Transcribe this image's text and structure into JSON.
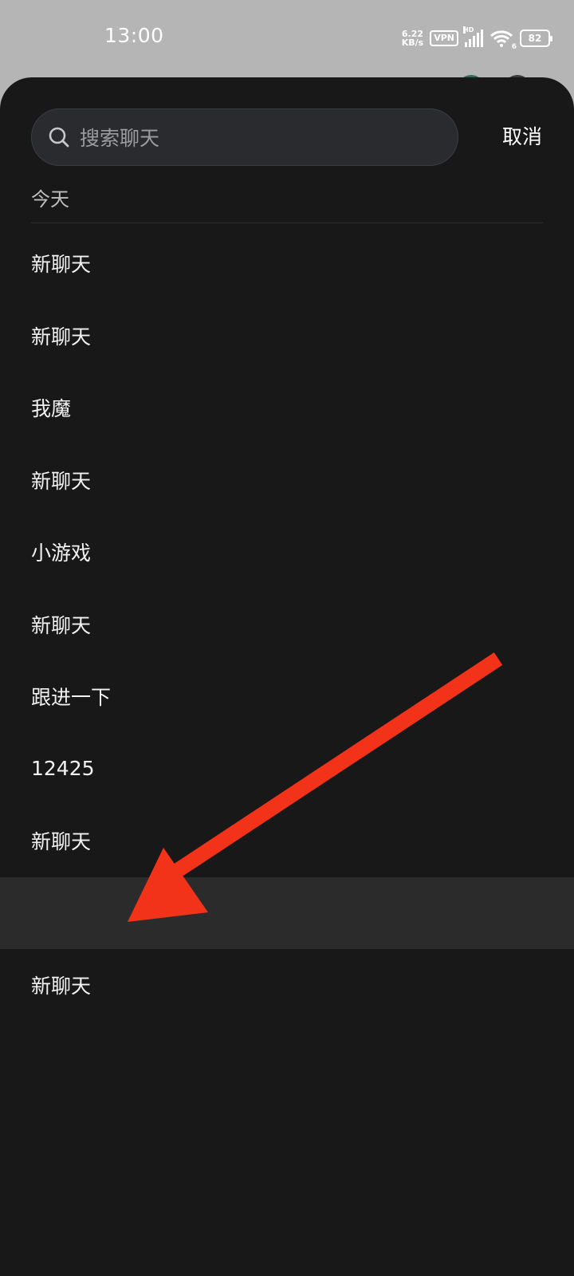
{
  "status_bar": {
    "time": "13:00",
    "speed_value": "6.22",
    "speed_unit": "KB/s",
    "vpn": "VPN",
    "hd": "HD",
    "wifi_badge": "6",
    "battery": "82"
  },
  "search": {
    "placeholder": "搜索聊天",
    "cancel_label": "取消"
  },
  "history": {
    "section_title": "今天",
    "items": [
      {
        "label": "新聊天"
      },
      {
        "label": "新聊天"
      },
      {
        "label": "我魔"
      },
      {
        "label": "新聊天"
      },
      {
        "label": "小游戏"
      },
      {
        "label": "新聊天"
      },
      {
        "label": "跟进一下"
      },
      {
        "label": "12425"
      },
      {
        "label": "新聊天"
      },
      {
        "label": ""
      },
      {
        "label": "新聊天"
      }
    ]
  },
  "colors": {
    "sheet_background": "#181819",
    "highlight_row": "#2b2b2c",
    "annotation_arrow": "#f2331a"
  },
  "icons": {
    "search": "search-icon",
    "annotation": "red-arrow-annotation"
  }
}
